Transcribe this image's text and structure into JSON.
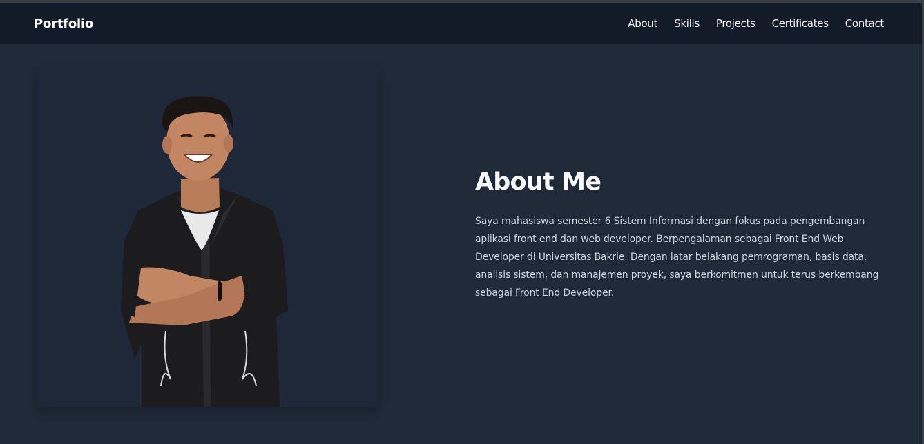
{
  "navbar": {
    "brand": "Portfolio",
    "links": [
      "About",
      "Skills",
      "Projects",
      "Certificates",
      "Contact"
    ]
  },
  "about": {
    "title": "About Me",
    "description": "Saya mahasiswa semester 6 Sistem Informasi dengan fokus pada pengembangan aplikasi front end dan web developer. Berpengalaman sebagai Front End Web Developer di Universitas Bakrie. Dengan latar belakang pemrograman, basis data, analisis sistem, dan manajemen proyek, saya berkomitmen untuk terus berkembang sebagai Front End Developer."
  },
  "colors": {
    "background": "#1f2937",
    "navbar": "#131a28",
    "text": "#cbd5e1"
  }
}
